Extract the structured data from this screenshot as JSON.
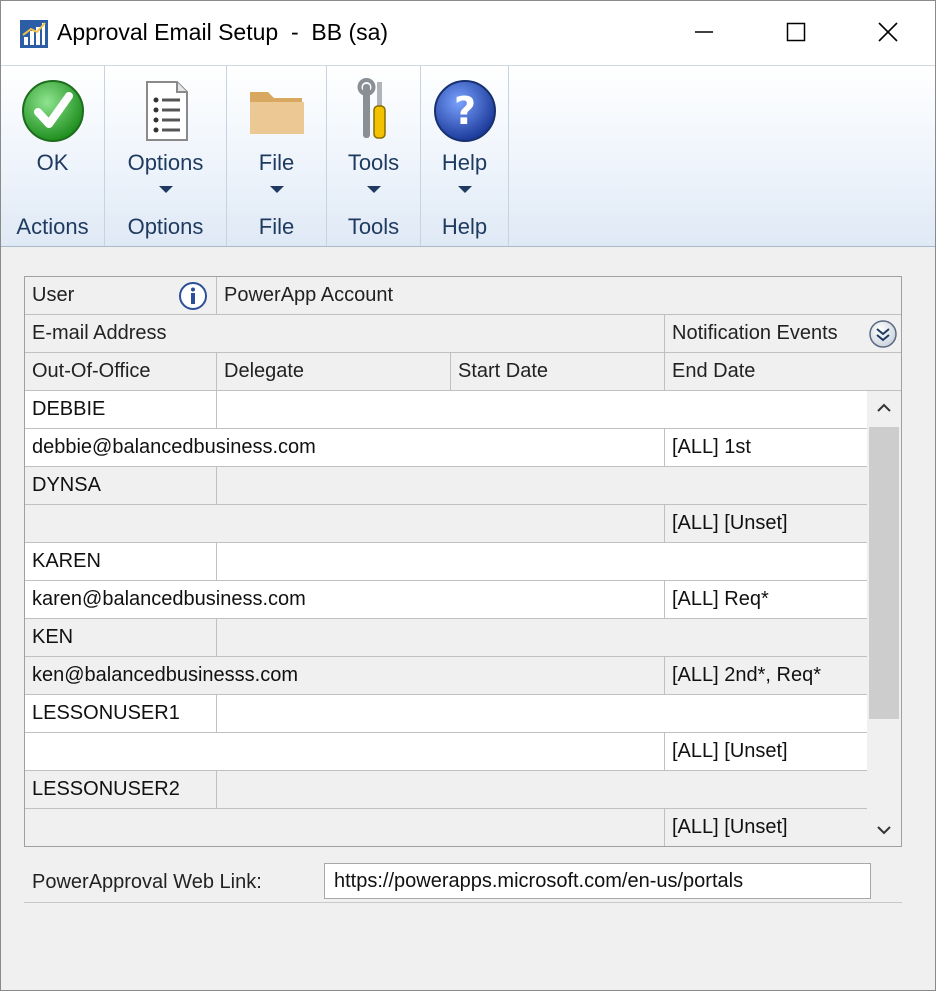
{
  "window": {
    "title": "Approval Email Setup  -  BB (sa)"
  },
  "ribbon": {
    "groups": [
      {
        "button": "OK",
        "group_label": "Actions",
        "icon": "ok-check-icon",
        "dropdown": false
      },
      {
        "button": "Options",
        "group_label": "Options",
        "icon": "options-list-icon",
        "dropdown": true
      },
      {
        "button": "File",
        "group_label": "File",
        "icon": "folder-icon",
        "dropdown": true
      },
      {
        "button": "Tools",
        "group_label": "Tools",
        "icon": "tools-icon",
        "dropdown": true
      },
      {
        "button": "Help",
        "group_label": "Help",
        "icon": "help-icon",
        "dropdown": true
      }
    ]
  },
  "grid": {
    "headers": {
      "row1": {
        "user": "User",
        "powerapp_account": "PowerApp Account"
      },
      "row2": {
        "email": "E-mail Address",
        "notification_events": "Notification Events"
      },
      "row3": {
        "out_of_office": "Out-Of-Office",
        "delegate": "Delegate",
        "start_date": "Start Date",
        "end_date": "End Date"
      }
    },
    "records": [
      {
        "user": "DEBBIE",
        "powerapp_account": "",
        "email": "debbie@balancedbusiness.com",
        "events": "[ALL] 1st",
        "selected": true
      },
      {
        "user": "DYNSA",
        "powerapp_account": "",
        "email": "",
        "events": "[ALL] [Unset]",
        "selected": false
      },
      {
        "user": "KAREN",
        "powerapp_account": "",
        "email": "karen@balancedbusiness.com",
        "events": "[ALL] Req*",
        "selected": true
      },
      {
        "user": "KEN",
        "powerapp_account": "",
        "email": "ken@balancedbusinesss.com",
        "events": "[ALL] 2nd*, Req*",
        "selected": false
      },
      {
        "user": "LESSONUSER1",
        "powerapp_account": "",
        "email": "",
        "events": "[ALL] [Unset]",
        "selected": true
      },
      {
        "user": "LESSONUSER2",
        "powerapp_account": "",
        "email": "",
        "events": "[ALL] [Unset]",
        "selected": false
      }
    ]
  },
  "web_link": {
    "label": "PowerApproval Web Link:",
    "value": "https://powerapps.microsoft.com/en-us/portals"
  },
  "colors": {
    "ribbon_text": "#1e3a5f",
    "grid_alt_row": "#f0f0f0",
    "ok_green": "#2aa52a",
    "help_blue": "#2a4fb4",
    "folder_tan": "#e2b67a"
  }
}
